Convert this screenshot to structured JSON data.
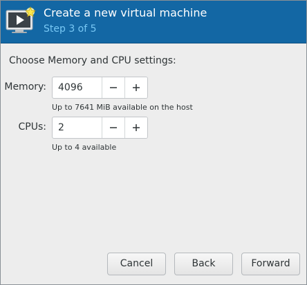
{
  "header": {
    "icon": "virtual-machine-icon",
    "title": "Create a new virtual machine",
    "step": "Step 3 of 5",
    "background_color": "#1367a4",
    "step_color": "#78c8f5"
  },
  "content": {
    "section_label": "Choose Memory and CPU settings:",
    "memory": {
      "label": "Memory:",
      "value": "4096",
      "decrement_icon": "minus-icon",
      "increment_icon": "plus-icon",
      "hint": "Up to 7641 MiB available on the host"
    },
    "cpus": {
      "label": "CPUs:",
      "value": "2",
      "decrement_icon": "minus-icon",
      "increment_icon": "plus-icon",
      "hint": "Up to 4 available"
    }
  },
  "footer": {
    "cancel_label": "Cancel",
    "back_label": "Back",
    "forward_label": "Forward"
  }
}
